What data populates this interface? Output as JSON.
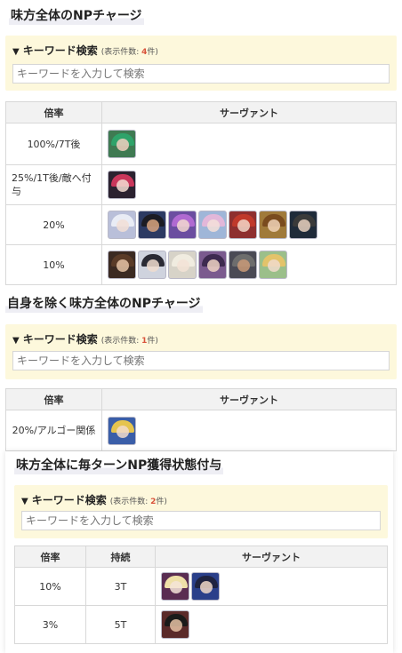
{
  "sections": [
    {
      "title": "味方全体のNPチャージ",
      "search": {
        "label": "キーワード検索",
        "count_prefix": "(表示件数: ",
        "count": "4",
        "count_suffix": "件)",
        "placeholder": "キーワードを入力して検索"
      },
      "headers": [
        "倍率",
        "サーヴァント"
      ],
      "rows": [
        {
          "rate": "100%/7T後",
          "icons": [
            {
              "name": "servant-icon",
              "bg": "#3f7a52",
              "hair": "#2fa36a",
              "face": "#f1d0c0"
            }
          ]
        },
        {
          "rate": "25%/1T後/敵へ付与",
          "icons": [
            {
              "name": "servant-icon",
              "bg": "#2b2230",
              "hair": "#c9365b",
              "face": "#f3ddd2"
            }
          ]
        },
        {
          "rate": "20%",
          "icons": [
            {
              "name": "servant-icon",
              "bg": "#b9bfd9",
              "hair": "#e9ecf5",
              "face": "#f2dfd6"
            },
            {
              "name": "servant-icon",
              "bg": "#2c3a63",
              "hair": "#1c1c24",
              "face": "#d9a47f"
            },
            {
              "name": "servant-icon",
              "bg": "#6b4ea0",
              "hair": "#b06ad1",
              "face": "#f3d8d0"
            },
            {
              "name": "servant-icon",
              "bg": "#9fb6d8",
              "hair": "#e2b7d9",
              "face": "#f5e1d9"
            },
            {
              "name": "servant-icon",
              "bg": "#8e2f2f",
              "hair": "#c0392b",
              "face": "#f2d6c8"
            },
            {
              "name": "servant-icon",
              "bg": "#a07a3a",
              "hair": "#7a4b1e",
              "face": "#f1d3b8"
            },
            {
              "name": "servant-icon",
              "bg": "#1f2b3a",
              "hair": "#3a3a3a",
              "face": "#e7d1bf"
            }
          ]
        },
        {
          "rate": "10%",
          "icons": [
            {
              "name": "servant-icon",
              "bg": "#3b2a22",
              "hair": "#5a3b28",
              "face": "#e6c4a6"
            },
            {
              "name": "servant-icon",
              "bg": "#cfd3de",
              "hair": "#2a2a34",
              "face": "#f0dccf"
            },
            {
              "name": "servant-icon",
              "bg": "#d7d3c8",
              "hair": "#f0ece0",
              "face": "#f3e3d6"
            },
            {
              "name": "servant-icon",
              "bg": "#7a5a8e",
              "hair": "#3d2a4f",
              "face": "#efd3c4"
            },
            {
              "name": "servant-icon",
              "bg": "#4a4a55",
              "hair": "#6d6d6d",
              "face": "#c99a78"
            },
            {
              "name": "servant-icon",
              "bg": "#9bbf8a",
              "hair": "#e3c36a",
              "face": "#f1dacb"
            }
          ]
        }
      ]
    },
    {
      "title": "自身を除く味方全体のNPチャージ",
      "search": {
        "label": "キーワード検索",
        "count_prefix": "(表示件数: ",
        "count": "1",
        "count_suffix": "件)",
        "placeholder": "キーワードを入力して検索"
      },
      "headers": [
        "倍率",
        "サーヴァント"
      ],
      "rows": [
        {
          "rate": "20%/アルゴー関係",
          "icons": [
            {
              "name": "servant-icon",
              "bg": "#3a5ea8",
              "hair": "#e5c44e",
              "face": "#f2dccb"
            }
          ]
        }
      ]
    },
    {
      "title": "味方全体に毎ターンNP獲得状態付与",
      "search": {
        "label": "キーワード検索",
        "count_prefix": "(表示件数: ",
        "count": "2",
        "count_suffix": "件)",
        "placeholder": "キーワードを入力して検索"
      },
      "headers": [
        "倍率",
        "持続",
        "サーヴァント"
      ],
      "rows": [
        {
          "rate": "10%",
          "duration": "3T",
          "icons": [
            {
              "name": "servant-icon",
              "bg": "#5a2d52",
              "hair": "#efe0a8",
              "face": "#f5e4d8"
            },
            {
              "name": "servant-icon",
              "bg": "#2a3f8a",
              "hair": "#1f2340",
              "face": "#f0d8c8"
            }
          ]
        },
        {
          "rate": "3%",
          "duration": "5T",
          "icons": [
            {
              "name": "servant-icon",
              "bg": "#5a2a2a",
              "hair": "#1a1a1a",
              "face": "#e6c2a4"
            }
          ]
        }
      ]
    }
  ]
}
